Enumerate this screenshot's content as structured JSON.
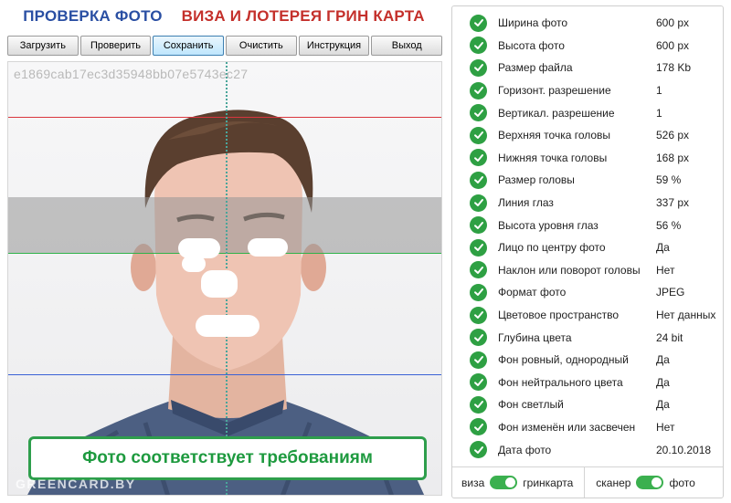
{
  "header": {
    "title_left": "ПРОВЕРКА ФОТО",
    "title_right": "ВИЗА И ЛОТЕРЕЯ ГРИН КАРТА"
  },
  "toolbar": {
    "load": "Загрузить",
    "check": "Проверить",
    "save": "Сохранить",
    "clear": "Очистить",
    "instructions": "Инструкция",
    "exit": "Выход"
  },
  "photo": {
    "id": "e1869cab17ec3d35948bb07e5743ec27",
    "verdict": "Фото соответствует требованиям",
    "watermark": "GREENCARD.BY"
  },
  "checks": [
    {
      "label": "Ширина фото",
      "value": "600 px"
    },
    {
      "label": "Высота фото",
      "value": "600 px"
    },
    {
      "label": "Размер файла",
      "value": "178 Kb"
    },
    {
      "label": "Горизонт. разрешение",
      "value": "1"
    },
    {
      "label": "Вертикал. разрешение",
      "value": "1"
    },
    {
      "label": "Верхняя точка головы",
      "value": "526 px"
    },
    {
      "label": "Нижняя точка головы",
      "value": "168 px"
    },
    {
      "label": "Размер головы",
      "value": "59 %"
    },
    {
      "label": "Линия глаз",
      "value": "337 px"
    },
    {
      "label": "Высота уровня глаз",
      "value": "56 %"
    },
    {
      "label": "Лицо по центру фото",
      "value": "Да"
    },
    {
      "label": "Наклон или поворот головы",
      "value": "Нет"
    },
    {
      "label": "Формат фото",
      "value": "JPEG"
    },
    {
      "label": "Цветовое пространство",
      "value": "Нет данных"
    },
    {
      "label": "Глубина цвета",
      "value": "24 bit"
    },
    {
      "label": "Фон ровный, однородный",
      "value": "Да"
    },
    {
      "label": "Фон нейтрального цвета",
      "value": "Да"
    },
    {
      "label": "Фон светлый",
      "value": "Да"
    },
    {
      "label": "Фон изменён или засвечен",
      "value": "Нет"
    },
    {
      "label": "Дата фото",
      "value": "20.10.2018"
    }
  ],
  "footer": {
    "mode_left": "виза",
    "mode_right": "гринкарта",
    "source_left": "сканер",
    "source_right": "фото"
  },
  "colors": {
    "accent_blue": "#2a4fa3",
    "accent_red": "#c4302b",
    "ok_green": "#2ea043",
    "verdict_green": "#1e9a3f"
  }
}
